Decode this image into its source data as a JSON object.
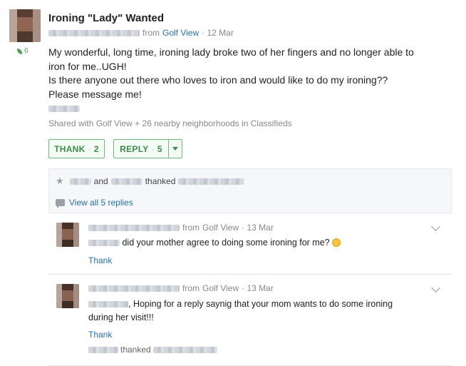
{
  "post": {
    "title": "Ironing \"Lady\" Wanted",
    "from_prefix": "from",
    "neighborhood": "Golf View",
    "date": "· 12 Mar",
    "thanks_count": "6",
    "body_line1": "My wonderful, long time, ironing lady broke two of her fingers and no longer able to",
    "body_line2": "iron for me..UGH!",
    "body_line3": "Is there anyone out there who loves to iron and would like to do my ironing??",
    "body_line4": "Please message me!",
    "shared": "Shared with Golf View + 26 nearby neighborhoods in Classifieds"
  },
  "actions": {
    "thank_label": "THANK",
    "thank_count": "2",
    "reply_label": "REPLY",
    "reply_count": "5",
    "sep": "·"
  },
  "thanks_row": {
    "and": "and",
    "thanked": "thanked"
  },
  "view_replies": "View all 5 replies",
  "replies": [
    {
      "from_prefix": "from",
      "neighborhood": "Golf View",
      "date": "· 13 Mar",
      "text": "did your mother agree to doing some ironing for me?",
      "thank": "Thank"
    },
    {
      "from_prefix": "from",
      "neighborhood": "Golf View",
      "date": "· 13 Mar",
      "text_line1": ", Hoping for a reply saynig that your mom wants to do some ironing",
      "text_line2": "during her visit!!!",
      "thank": "Thank",
      "thanked": "thanked"
    }
  ],
  "colors": {
    "link": "#2a6ea8",
    "green": "#3d8a4b",
    "muted": "#888888"
  }
}
